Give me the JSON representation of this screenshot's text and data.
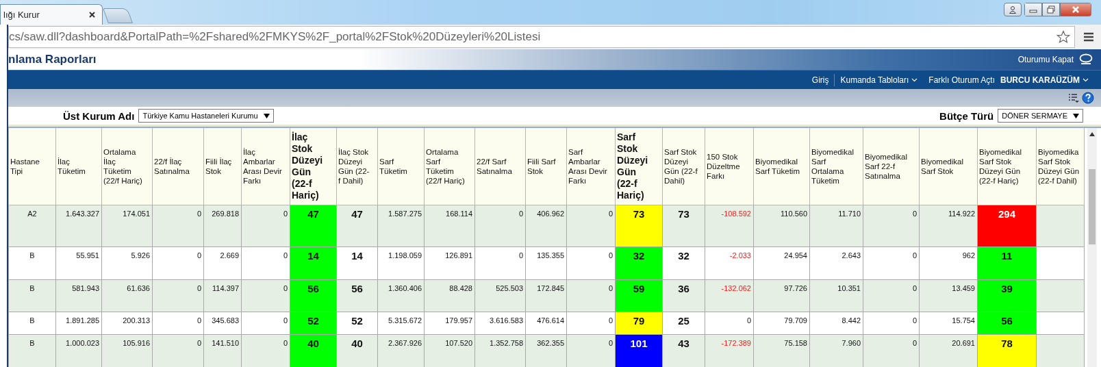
{
  "browser": {
    "tab_title": "lığı Kurur",
    "address": "cs/saw.dll?dashboard&PortalPath=%2Fshared%2FMKYS%2F_portal%2FStok%20Düzeyleri%20Listesi"
  },
  "header": {
    "title": "nlama Raporları",
    "logout": "Oturumu Kapat"
  },
  "nav": [
    {
      "label": "Giriş",
      "dropdown": false
    },
    {
      "label": "Kumanda Tabloları",
      "dropdown": true
    },
    {
      "label": "Farklı Oturum Açtı",
      "dropdown": false
    }
  ],
  "user": {
    "name": "BURCU KARAÜZÜM",
    "dropdown": true
  },
  "filters": [
    {
      "label": "Üst Kurum Adı",
      "value": "Türkiye Kamu Hastaneleri Kurumu"
    },
    {
      "label": "Bütçe Türü",
      "value": "DÖNER SERMAYE"
    }
  ],
  "table": {
    "columns": [
      {
        "label": "Hastane Tipi",
        "kind": "center",
        "bold": false
      },
      {
        "label": "İlaç Tüketim",
        "kind": "number",
        "bold": false
      },
      {
        "label": "Ortalama İlaç Tüketim (22/f Hariç)",
        "kind": "number",
        "bold": false
      },
      {
        "label": "22/f İlaç Satınalma",
        "kind": "number",
        "bold": false
      },
      {
        "label": "Fiili İlaç Stok",
        "kind": "number",
        "bold": false
      },
      {
        "label": "İlaç Ambarlar Arası Devir Farkı",
        "kind": "number",
        "bold": false
      },
      {
        "label": "İlaç Stok Düzeyi Gün (22-f Hariç)",
        "kind": "level",
        "bold": true
      },
      {
        "label": "İlaç Stok Düzeyi Gün (22-f Dahil)",
        "kind": "strong",
        "bold": false
      },
      {
        "label": "Sarf Tüketim",
        "kind": "number",
        "bold": false
      },
      {
        "label": "Ortalama Sarf Tüketim (22/f Hariç)",
        "kind": "number",
        "bold": false
      },
      {
        "label": "22/f Sarf Satınalma",
        "kind": "number",
        "bold": false
      },
      {
        "label": "Fiili Sarf Stok",
        "kind": "number",
        "bold": false
      },
      {
        "label": "Sarf Ambarlar Arası Devir Farkı",
        "kind": "number",
        "bold": false
      },
      {
        "label": "Sarf Stok Düzeyi Gün (22-f Hariç)",
        "kind": "level",
        "bold": true
      },
      {
        "label": "Sarf Stok Düzeyi Gün (22-f Dahil)",
        "kind": "strong",
        "bold": false
      },
      {
        "label": "150 Stok Düzeltme Farkı",
        "kind": "diff",
        "bold": false
      },
      {
        "label": "Biyomedikal Sarf Tüketim",
        "kind": "number",
        "bold": false
      },
      {
        "label": "Biyomedikal Sarf Ortalama Tüketim",
        "kind": "number",
        "bold": false
      },
      {
        "label": "Biyomedikal Sarf 22-f Satınalma",
        "kind": "number",
        "bold": false
      },
      {
        "label": "Biyomedikal Sarf Stok",
        "kind": "number",
        "bold": false
      },
      {
        "label": "Biyomedikal Sarf Stok Düzeyi Gün (22-f Hariç)",
        "kind": "level",
        "bold": false
      },
      {
        "label": "Biyomedika Sarf Stok Düzeyi Gün (22-f Dahil)",
        "kind": "strong",
        "bold": false
      }
    ],
    "rows": [
      {
        "cells": [
          "A2",
          "1.643.327",
          "174.051",
          "0",
          "269.818",
          "0",
          {
            "text": "47",
            "color": "#00ff00"
          },
          "47",
          "1.587.275",
          "168.114",
          "0",
          "406.962",
          "0",
          {
            "text": "73",
            "color": "#ffff00"
          },
          "73",
          {
            "text": "-108.592",
            "negative": true
          },
          "110.560",
          "11.710",
          "0",
          "114.922",
          {
            "text": "294",
            "color": "#ff0000"
          }
        ]
      },
      {
        "cells": [
          "B",
          "55.951",
          "5.926",
          "0",
          "2.669",
          "0",
          {
            "text": "14",
            "color": "#00ff00"
          },
          "14",
          "1.198.059",
          "126.891",
          "0",
          "135.355",
          "0",
          {
            "text": "32",
            "color": "#00ff00"
          },
          "32",
          {
            "text": "-2.033",
            "negative": true
          },
          "24.954",
          "2.643",
          "0",
          "962",
          {
            "text": "11",
            "color": "#00ff00"
          }
        ]
      },
      {
        "cells": [
          "B",
          "581.943",
          "61.636",
          "0",
          "114.397",
          "0",
          {
            "text": "56",
            "color": "#00ff00"
          },
          "56",
          "1.360.406",
          "88.428",
          "525.503",
          "172.845",
          "0",
          {
            "text": "59",
            "color": "#00ff00"
          },
          "36",
          {
            "text": "-132.062",
            "negative": true
          },
          "97.726",
          "10.351",
          "0",
          "13.459",
          {
            "text": "39",
            "color": "#00ff00"
          }
        ]
      },
      {
        "cells": [
          "B",
          "1.891.285",
          "200.313",
          "0",
          "345.683",
          "0",
          {
            "text": "52",
            "color": "#00ff00"
          },
          "52",
          "5.315.672",
          "179.957",
          "3.616.583",
          "476.614",
          "0",
          {
            "text": "79",
            "color": "#ffff00"
          },
          "25",
          {
            "text": "0",
            "negative": false
          },
          "79.709",
          "8.442",
          "0",
          "15.754",
          {
            "text": "56",
            "color": "#00ff00"
          }
        ]
      },
      {
        "cells": [
          "B",
          "1.000.023",
          "105.916",
          "0",
          "141.510",
          "0",
          {
            "text": "40",
            "color": "#00ff00"
          },
          "40",
          "2.367.926",
          "107.520",
          "1.352.758",
          "362.355",
          "0",
          {
            "text": "101",
            "color": "#0000ff"
          },
          "43",
          {
            "text": "-172.389",
            "negative": true
          },
          "75.158",
          "7.960",
          "0",
          "20.691",
          {
            "text": "78",
            "color": "#ffff00"
          }
        ]
      }
    ]
  }
}
